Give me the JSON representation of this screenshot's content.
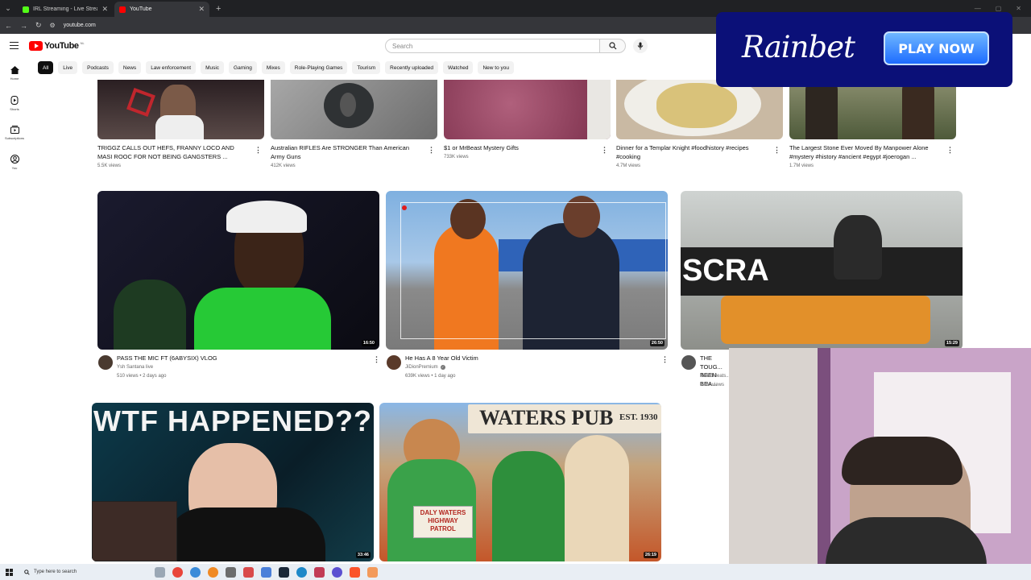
{
  "browser": {
    "tabs": [
      {
        "title": "IRL Streaming - Live Streams on",
        "active": false,
        "color": "#53fc18"
      },
      {
        "title": "YouTube",
        "active": true,
        "color": "#ff0000"
      }
    ],
    "url": "youtube.com"
  },
  "yt": {
    "logo": "YouTube",
    "country": "NL",
    "search_placeholder": "Search"
  },
  "chips": [
    "All",
    "Live",
    "Podcasts",
    "News",
    "Law enforcement",
    "Music",
    "Gaming",
    "Mixes",
    "Role-Playing Games",
    "Tourism",
    "Recently uploaded",
    "Watched",
    "New to you"
  ],
  "sidebar": [
    {
      "label": "Home",
      "icon": "home-icon"
    },
    {
      "label": "Shorts",
      "icon": "shorts-icon"
    },
    {
      "label": "Subscriptions",
      "icon": "subscriptions-icon"
    },
    {
      "label": "You",
      "icon": "you-icon"
    }
  ],
  "ad": {
    "brand": "Rainbet",
    "cta": "PLAY NOW"
  },
  "shorts_row": [
    {
      "title": "TRIGGZ CALLS OUT HEFS, FRANNY LOCO AND MASI ROOC FOR NOT BEING GANGSTERS ...",
      "views": "5.5K views"
    },
    {
      "title": "Australian RIFLES Are STRONGER Than American Army Guns",
      "views": "412K views"
    },
    {
      "title": "$1 or MrBeast Mystery Gifts",
      "views": "733K views"
    },
    {
      "title": "Dinner for a Templar Knight #foodhistory #recipes #cooking",
      "views": "4.7M views"
    },
    {
      "title": "The Largest Stone Ever Moved By Manpower Alone #mystery #history #ancient #egypt #joerogan ...",
      "views": "1.7M views"
    }
  ],
  "videos_row": [
    {
      "title": "PASS THE MIC FT (6ABYSIX) VLOG",
      "channel": "Ysh Santana live",
      "meta": "510 views • 2 days ago",
      "duration": "16:50"
    },
    {
      "title": "He Has A 8 Year Old Victim",
      "channel": "JiDionPremium",
      "meta": "639K views • 1 day ago",
      "duration": "26:50"
    },
    {
      "title": "THE TOUG... BEEN BEA...",
      "channel": "BeardMeats...",
      "meta": "6.6M views",
      "duration": "15:29"
    }
  ],
  "bottom_row": [
    {
      "thumb_text": "WTF HAPPENED??",
      "duration": "33:46"
    },
    {
      "thumb_text": "WATERS PUB",
      "sign_text": "DALY WATERS HIGHWAY PATROL",
      "year": "EST. 1930",
      "duration": "26:19"
    }
  ],
  "thumb_texts": {
    "scran": "SCRA"
  },
  "taskbar": {
    "search_placeholder": "Type here to search"
  }
}
